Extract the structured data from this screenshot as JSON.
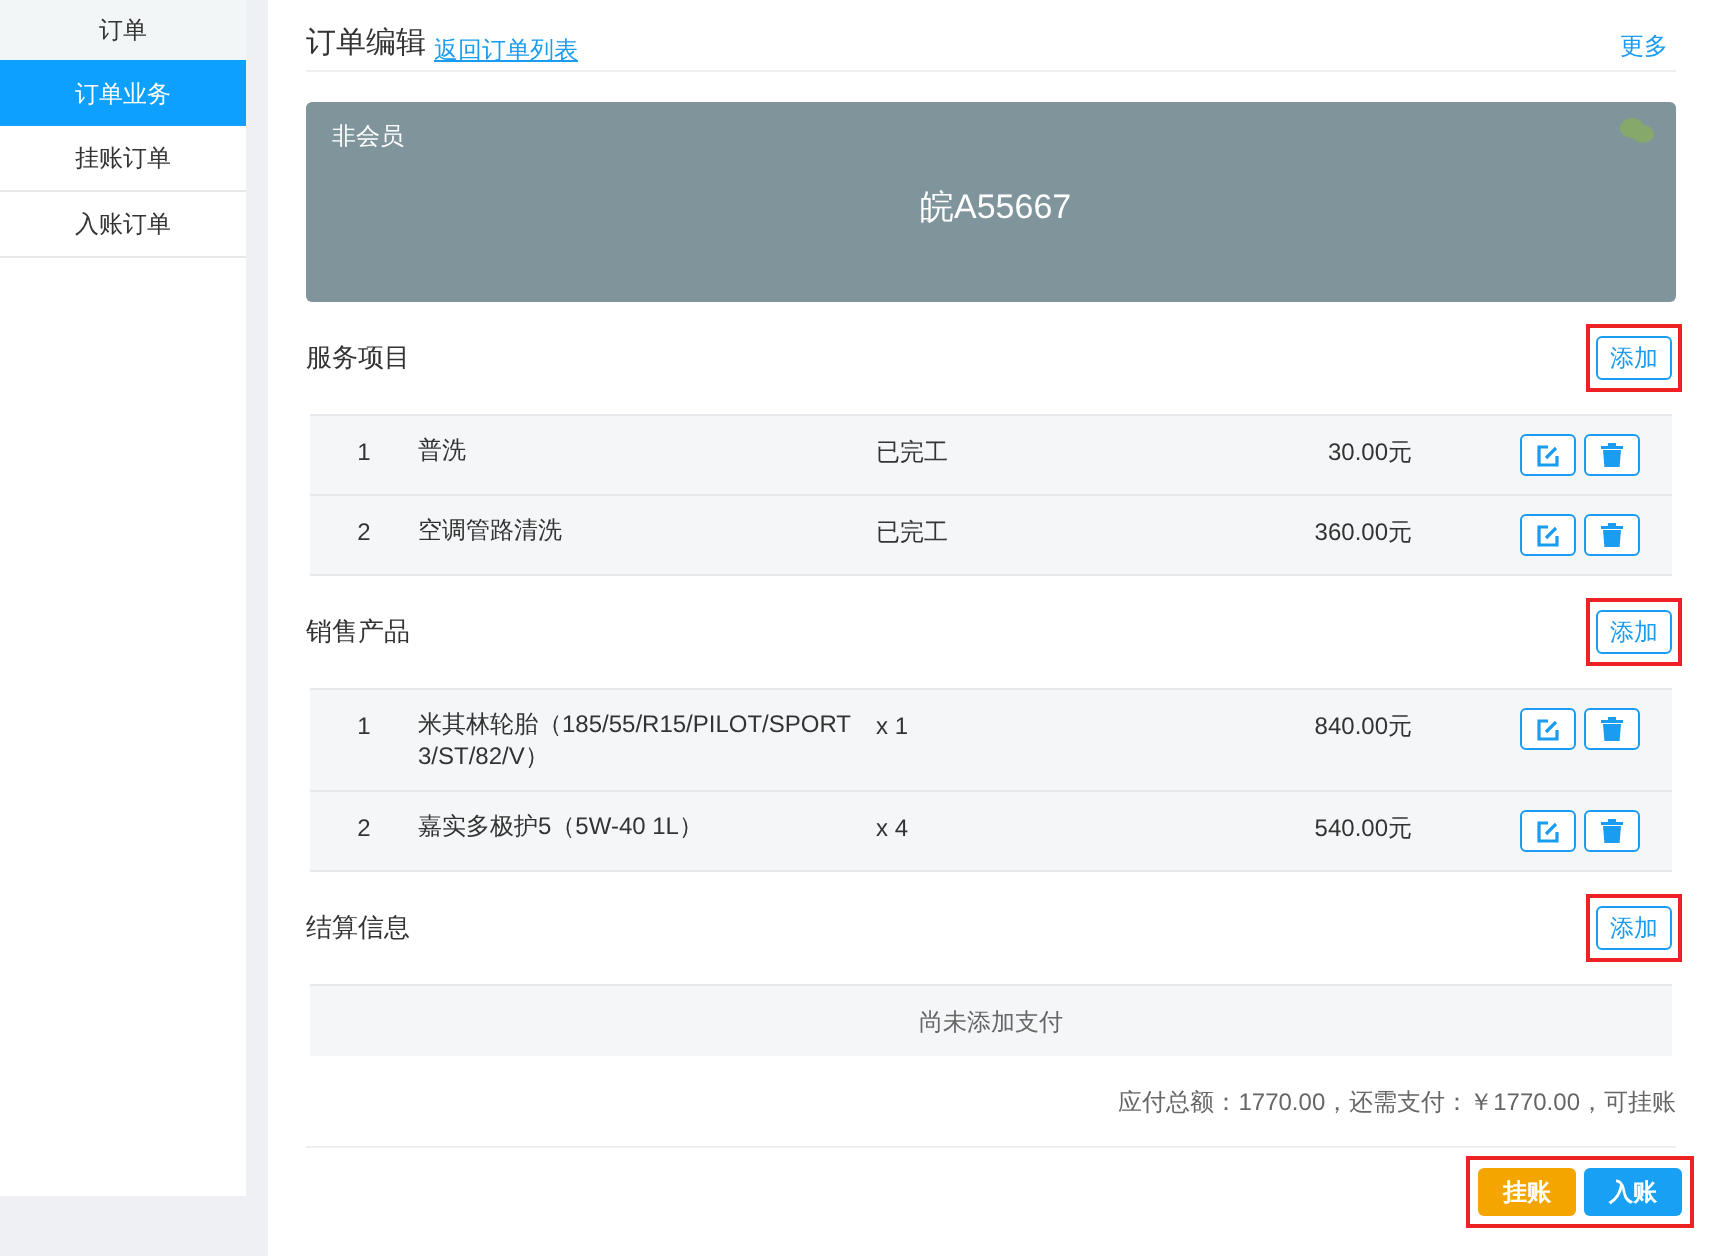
{
  "sidebar": {
    "header": "订单",
    "items": [
      {
        "label": "订单业务",
        "selected": true
      },
      {
        "label": "挂账订单",
        "selected": false
      },
      {
        "label": "入账订单",
        "selected": false
      }
    ]
  },
  "page": {
    "title": "订单编辑",
    "back_link": "返回订单列表",
    "more": "更多"
  },
  "vehicle_card": {
    "member_status": "非会员",
    "plate": "皖A55667"
  },
  "sections": [
    {
      "title": "服务项目",
      "add_button": "添加",
      "highlighted": true,
      "rows": [
        {
          "index": "1",
          "name": "普洗",
          "detail": "已完工",
          "amount": "30.00元"
        },
        {
          "index": "2",
          "name": "空调管路清洗",
          "detail": "已完工",
          "amount": "360.00元"
        }
      ]
    },
    {
      "title": "销售产品",
      "add_button": "添加",
      "highlighted": true,
      "rows": [
        {
          "index": "1",
          "name": "米其林轮胎（185/55/R15/PILOT/SPORT 3/ST/82/V）",
          "detail": "x 1",
          "amount": "840.00元"
        },
        {
          "index": "2",
          "name": "嘉实多极护5（5W-40 1L）",
          "detail": "x 4",
          "amount": "540.00元"
        }
      ]
    },
    {
      "title": "结算信息",
      "add_button": "添加",
      "highlighted": true,
      "empty_text": "尚未添加支付"
    }
  ],
  "summary": "应付总额：1770.00，还需支付：￥1770.00，可挂账",
  "actions": {
    "highlighted": true,
    "buttons": [
      {
        "label": "挂账",
        "kind": "warning"
      },
      {
        "label": "入账",
        "kind": "primary"
      }
    ]
  }
}
